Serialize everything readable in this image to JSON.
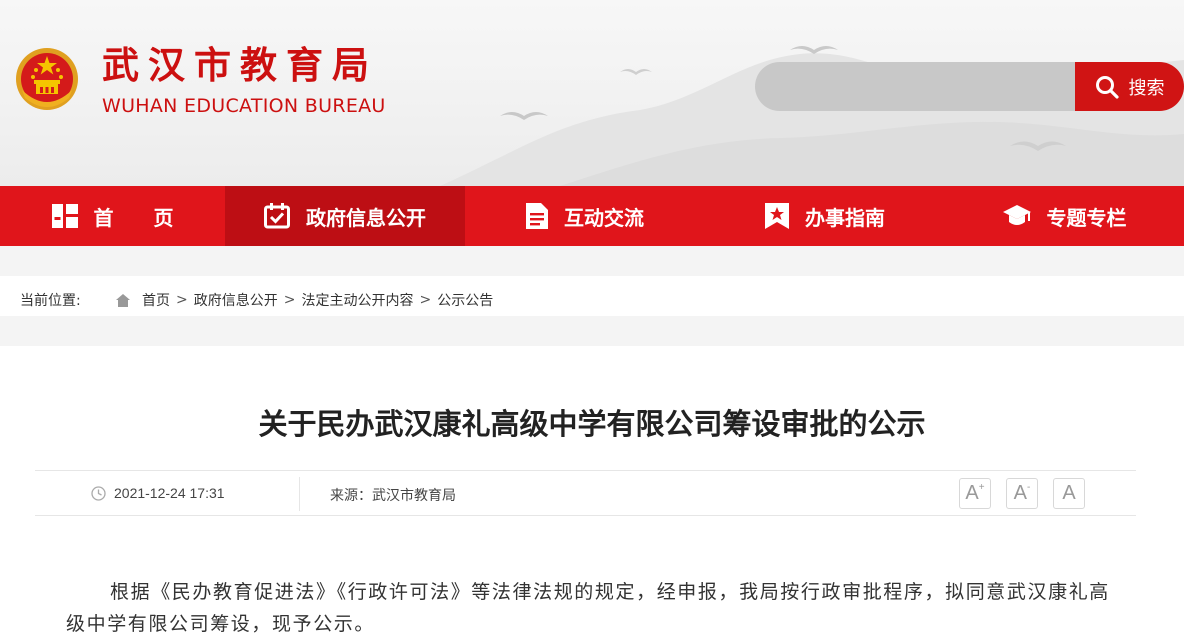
{
  "header": {
    "site_name_cn": "武汉市教育局",
    "site_name_en": "WUHAN EDUCATION BUREAU",
    "emblem_icon": "national-emblem-icon",
    "search": {
      "placeholder": "",
      "button_label": "搜索",
      "icon": "search-icon"
    }
  },
  "nav": {
    "items": [
      {
        "label": "首　　页",
        "icon": "home-grid-icon",
        "active": false
      },
      {
        "label": "政府信息公开",
        "icon": "calendar-check-icon",
        "active": true
      },
      {
        "label": "互动交流",
        "icon": "document-icon",
        "active": false
      },
      {
        "label": "办事指南",
        "icon": "bookmark-star-icon",
        "active": false
      },
      {
        "label": "专题专栏",
        "icon": "graduation-cap-icon",
        "active": false
      }
    ]
  },
  "breadcrumb": {
    "label": "当前位置:",
    "home_icon": "home-icon",
    "items": [
      "首页",
      "政府信息公开",
      "法定主动公开内容",
      "公示公告"
    ],
    "separator": ">"
  },
  "article": {
    "title": "关于民办武汉康礼高级中学有限公司筹设审批的公示",
    "date": "2021-12-24 17:31",
    "clock_icon": "clock-icon",
    "source": "来源：武汉市教育局",
    "font_sizes": [
      "A+",
      "A-",
      "A"
    ],
    "body": "根据《民办教育促进法》《行政许可法》等法律法规的规定，经申报，我局按行政审批程序，拟同意武汉康礼高级中学有限公司筹设，现予公示。"
  },
  "colors": {
    "brand_red": "#e0151b",
    "active_red": "#bd0e14",
    "search_red": "#d01414",
    "title_red": "#cc1010"
  }
}
